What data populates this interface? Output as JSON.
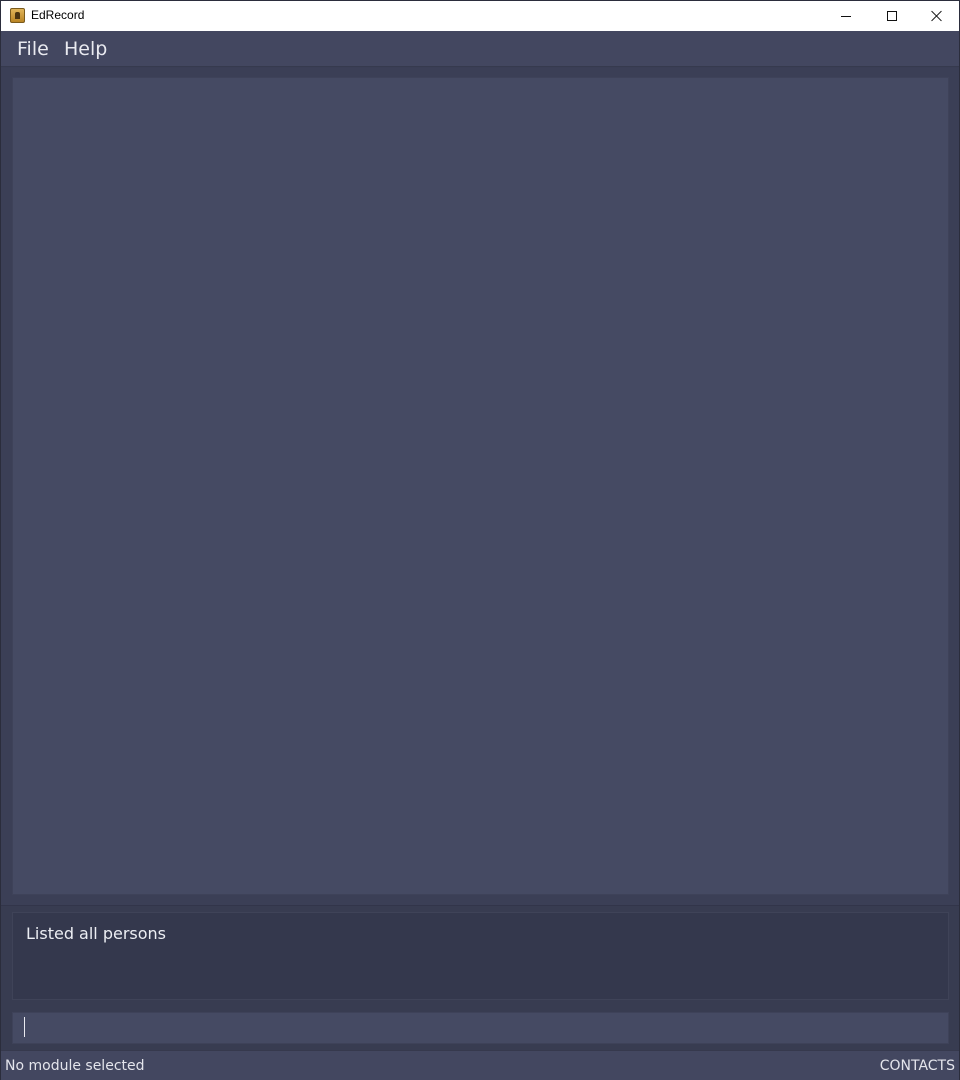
{
  "window": {
    "title": "EdRecord",
    "app_icon": "address-book-icon",
    "controls": {
      "minimize_icon": "minimize-icon",
      "maximize_icon": "maximize-icon",
      "close_icon": "close-icon"
    }
  },
  "menubar": {
    "items": [
      {
        "label": "File"
      },
      {
        "label": "Help"
      }
    ]
  },
  "result_display": {
    "text": "Listed all persons"
  },
  "command_box": {
    "value": "",
    "placeholder": ""
  },
  "statusbar": {
    "module_status": "No module selected",
    "view_mode": "CONTACTS"
  },
  "colors": {
    "background": "#3a3e55",
    "panel": "#454a63",
    "menubar": "#434760",
    "text": "#e9eaf0"
  }
}
